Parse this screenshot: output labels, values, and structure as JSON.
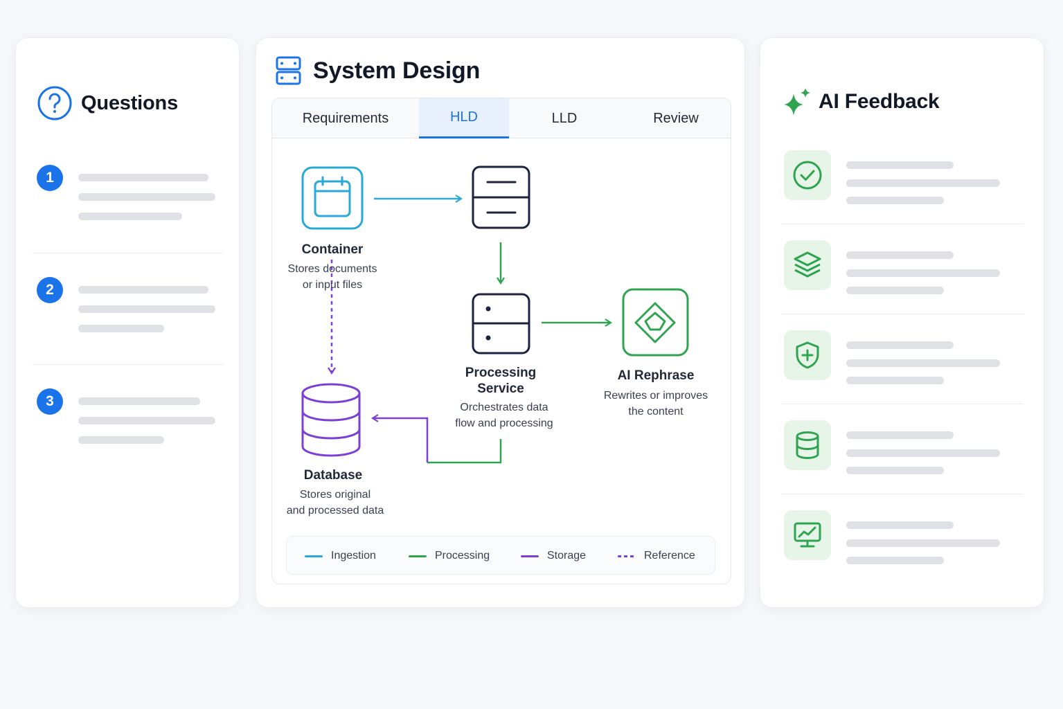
{
  "questions": {
    "title": "Questions",
    "icon": "question-circle-icon",
    "items": [
      {
        "number": "1"
      },
      {
        "number": "2"
      },
      {
        "number": "3"
      }
    ]
  },
  "system_design": {
    "title": "System Design",
    "icon": "server-icon",
    "tabs": [
      {
        "label": "Requirements",
        "active": false
      },
      {
        "label": "HLD",
        "active": true
      },
      {
        "label": "LLD",
        "active": false
      },
      {
        "label": "Review",
        "active": false
      }
    ],
    "nodes": {
      "container": {
        "label": "Container",
        "desc_line1": "Stores documents",
        "desc_line2": "or input files",
        "icon": "calendar-icon"
      },
      "server": {
        "icon": "server-icon"
      },
      "processing": {
        "label_line1": "Processing",
        "label_line2": "Service",
        "desc_line1": "Orchestrates data",
        "desc_line2": "flow and processing",
        "icon": "server-icon"
      },
      "ai_rephrase": {
        "label": "AI Rephrase",
        "desc_line1": "Rewrites or improves",
        "desc_line2": "the content",
        "icon": "diamond-icon"
      },
      "database": {
        "label": "Database",
        "desc_line1": "Stores original",
        "desc_line2": "and processed data",
        "icon": "database-icon"
      }
    },
    "legend": [
      {
        "label": "Ingestion",
        "color": "#28a9d6",
        "style": "solid"
      },
      {
        "label": "Processing",
        "color": "#2ea44f",
        "style": "solid"
      },
      {
        "label": "Storage",
        "color": "#7b3fd6",
        "style": "solid"
      },
      {
        "label": "Reference",
        "color": "#7b3fd6",
        "style": "dashed"
      }
    ]
  },
  "ai_feedback": {
    "title": "AI Feedback",
    "icon": "sparkle-icon",
    "items": [
      {
        "icon": "check-circle-icon"
      },
      {
        "icon": "layers-icon"
      },
      {
        "icon": "shield-plus-icon"
      },
      {
        "icon": "database-icon"
      },
      {
        "icon": "monitor-chart-icon"
      }
    ]
  },
  "colors": {
    "accent_blue": "#1a73e8",
    "ingestion_cyan": "#28a9d6",
    "processing_green": "#2ea44f",
    "storage_purple": "#7b3fd6",
    "dark_navy": "#1b2340",
    "skeleton_gray": "#dfe1e5",
    "feedback_tile_bg": "#e7f4e8"
  }
}
